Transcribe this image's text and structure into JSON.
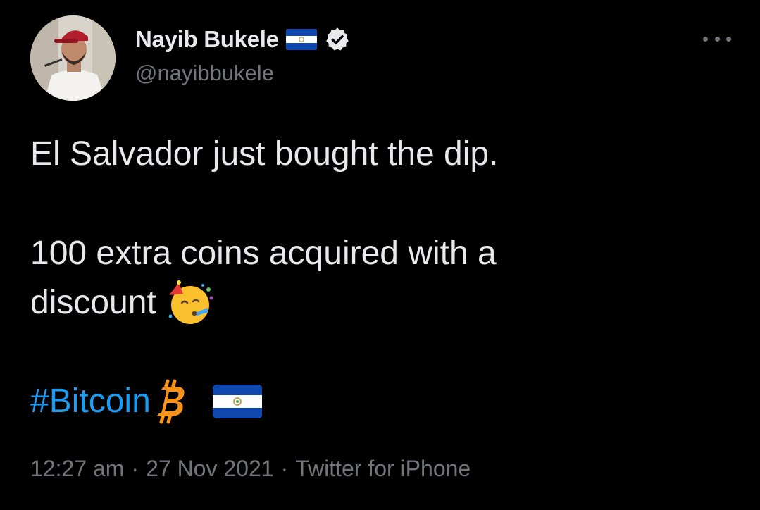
{
  "user": {
    "display_name": "Nayib Bukele",
    "handle": "@nayibbukele",
    "flag_icon": "el-salvador-flag-icon",
    "verified_icon": "verified-badge-icon",
    "avatar": "profile-photo"
  },
  "menu": {
    "more_icon": "more-horizontal-icon"
  },
  "tweet": {
    "line1": "El Salvador just bought the dip.",
    "line2": "100 extra coins acquired with a",
    "line3": "discount",
    "line3_emoji": "partying-face-emoji",
    "hashtag": "#Bitcoin",
    "hashtag_icon": "bitcoin-icon",
    "hashtag_flag_icon": "el-salvador-flag-icon"
  },
  "meta": {
    "time": "12:27 am",
    "date": "27 Nov 2021",
    "separator": "·",
    "source": "Twitter for iPhone"
  },
  "colors": {
    "background": "#000000",
    "text": "#e7e9ea",
    "secondary": "#71767b",
    "link": "#1d9bf0",
    "bitcoin": "#f7931a",
    "flag_blue": "#0f47af"
  }
}
